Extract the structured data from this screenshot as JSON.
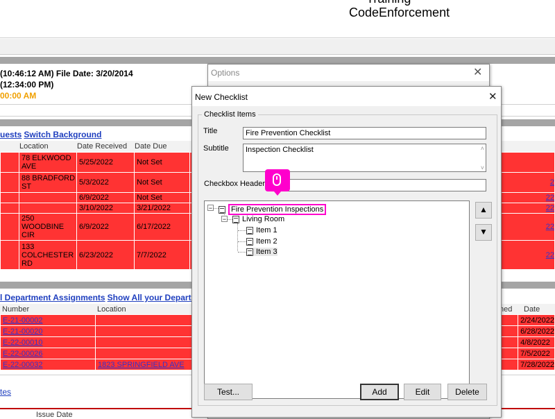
{
  "header": {
    "app_partial": "Training",
    "app_name": "CodeEnforcement"
  },
  "info": {
    "line1": "(10:46:12 AM) File Date: 3/20/2014",
    "line2": "(12:34:00 PM)",
    "line3": "00:00 AM"
  },
  "section1": {
    "links": [
      "uests",
      "Switch Background"
    ],
    "columns": [
      "Location",
      "Date Received",
      "Date Due"
    ],
    "rows": [
      {
        "location": "78 ELKWOOD AVE",
        "received": "5/25/2022",
        "due": "Not Set",
        "extra": ""
      },
      {
        "location": "88 BRADFORD ST",
        "received": "5/3/2022",
        "due": "Not Set",
        "extra": "2"
      },
      {
        "location": "",
        "received": "6/9/2022",
        "due": "Not Set",
        "extra": "22"
      },
      {
        "location": "",
        "received": "3/10/2022",
        "due": "3/21/2022",
        "extra": "22"
      },
      {
        "location": "250 WOODBINE CIR",
        "received": "6/9/2022",
        "due": "6/17/2022",
        "extra": "22"
      },
      {
        "location": "133 COLCHESTER RD",
        "received": "6/23/2022",
        "due": "7/7/2022",
        "extra": "22"
      }
    ]
  },
  "section2": {
    "links": [
      "l Department Assignments",
      "Show All your Departm"
    ],
    "columns": [
      "Number",
      "Location",
      "ned",
      "Date Due"
    ],
    "rows": [
      {
        "number": "E-21-00002",
        "location": "",
        "due": "2/24/2022"
      },
      {
        "number": "E-21-00020",
        "location": "",
        "due": "6/28/2022"
      },
      {
        "number": "E-22-00010",
        "location": "",
        "due": "4/8/2022"
      },
      {
        "number": "E-22-00026",
        "location": "",
        "due": "7/5/2022"
      },
      {
        "number": "E-22-00032",
        "location": "1823 SPRINGFIELD AVE",
        "due": "7/28/2022"
      }
    ]
  },
  "bottom": {
    "link": "tes",
    "issue_date": "Issue Date"
  },
  "options_dialog": {
    "title": "Options"
  },
  "checklist_dialog": {
    "title": "New Checklist",
    "group_label": "Checklist Items",
    "title_label": "Title",
    "title_value": "Fire Prevention Checklist",
    "subtitle_label": "Subtitle",
    "subtitle_value": "Inspection Checklist",
    "checkbox_header_label": "Checkbox Header",
    "checkbox_header_value": "o",
    "tree": {
      "root": "Fire Prevention Inspections",
      "child": "Living Room",
      "items": [
        "Item 1",
        "Item 2",
        "Item 3"
      ]
    },
    "buttons": {
      "test": "Test...",
      "add": "Add",
      "edit": "Edit",
      "delete": "Delete"
    }
  },
  "colors": {
    "row_red": "#ff3333",
    "highlight": "#ff00cc",
    "link": "#1f3fbf",
    "orange": "#f0a000"
  },
  "icons": {
    "cursor_hint": "mouse-icon",
    "close": "close-icon",
    "up": "arrow-up-icon",
    "down": "arrow-down-icon"
  }
}
